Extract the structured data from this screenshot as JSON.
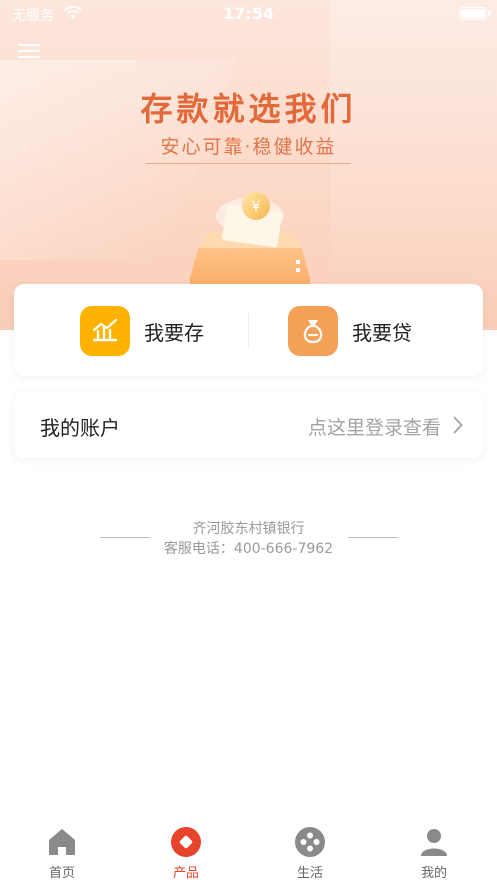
{
  "status_bar": {
    "carrier": "无服务",
    "time": "17:54"
  },
  "hero": {
    "title": "存款就选我们",
    "subtitle": "安心可靠·稳健收益"
  },
  "actions": {
    "deposit_label": "我要存",
    "loan_label": "我要贷"
  },
  "account": {
    "title": "我的账户",
    "login_hint": "点这里登录查看"
  },
  "footer": {
    "bank_name": "齐河胶东村镇银行",
    "service_phone": "客服电话：400-666-7962"
  },
  "tab_bar": {
    "items": [
      {
        "label": "首页",
        "icon": "home-icon",
        "active": false
      },
      {
        "label": "产品",
        "icon": "products-icon",
        "active": true
      },
      {
        "label": "生活",
        "icon": "life-icon",
        "active": false
      },
      {
        "label": "我的",
        "icon": "profile-icon",
        "active": false
      }
    ]
  },
  "colors": {
    "accent": "#e8442c",
    "hero_title": "#e26a3a",
    "deposit_icon_bg": "#ffb300",
    "loan_icon_bg": "#f5a057",
    "inactive_tab": "#8a8a8a"
  }
}
